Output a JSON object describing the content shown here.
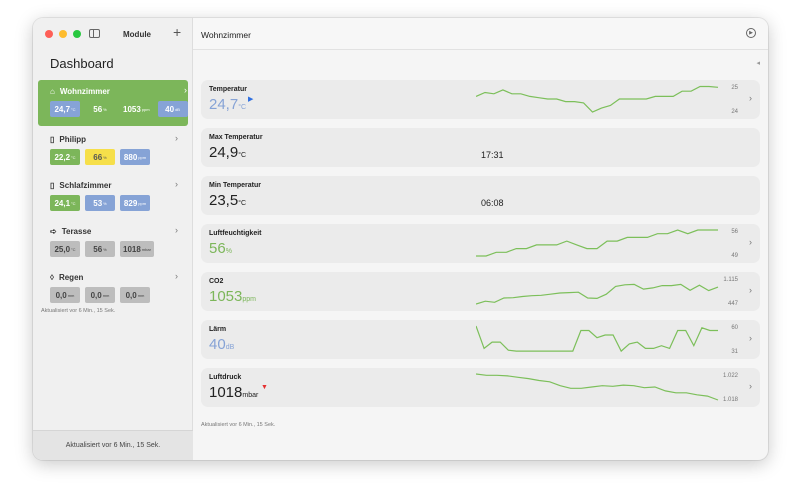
{
  "colors": {
    "green": "#7cb65a",
    "blue": "#86a3d6",
    "yellow": "#f6df4a",
    "gray": "#bdbdbd",
    "selected": "#7cb65a",
    "line": "#7cbf5a",
    "up": "#2f6fe0",
    "down": "#e53030"
  },
  "sidebar": {
    "title": "Module",
    "heading": "Dashboard",
    "updated": "Aktualisiert vor 6 Min., 15 Sek.",
    "footer": "Aktualisiert vor 6 Min., 15 Sek.",
    "rooms": [
      {
        "name": "Wohnzimmer",
        "icon": "house-icon",
        "selected": true,
        "chips": [
          {
            "v": "24,7",
            "u": "°C",
            "c": "blue"
          },
          {
            "v": "56",
            "u": "%",
            "c": "green"
          },
          {
            "v": "1053",
            "u": "ppm",
            "c": "green"
          },
          {
            "v": "40",
            "u": "dB",
            "c": "blue"
          }
        ]
      },
      {
        "name": "Philipp",
        "icon": "device-icon",
        "chips": [
          {
            "v": "22,2",
            "u": "°C",
            "c": "green"
          },
          {
            "v": "66",
            "u": "%",
            "c": "yellow"
          },
          {
            "v": "880",
            "u": "ppm",
            "c": "blue"
          }
        ]
      },
      {
        "name": "Schlafzimmer",
        "icon": "device-icon",
        "chips": [
          {
            "v": "24,1",
            "u": "°C",
            "c": "green"
          },
          {
            "v": "53",
            "u": "%",
            "c": "blue"
          },
          {
            "v": "829",
            "u": "ppm",
            "c": "blue"
          }
        ]
      },
      {
        "name": "Terasse",
        "icon": "wind-icon",
        "chips": [
          {
            "v": "25,0",
            "u": "°C",
            "c": "gray"
          },
          {
            "v": "56",
            "u": "%",
            "c": "gray"
          },
          {
            "v": "1018",
            "u": "mbar",
            "c": "gray"
          }
        ]
      },
      {
        "name": "Regen",
        "icon": "drop-icon",
        "chips": [
          {
            "v": "0,0",
            "u": "mm",
            "c": "gray"
          },
          {
            "v": "0,0",
            "u": "mm",
            "c": "gray"
          },
          {
            "v": "0,0",
            "u": "mm",
            "c": "gray"
          }
        ]
      }
    ]
  },
  "main": {
    "title": "Wohnzimmer",
    "updated": "Aktualisiert vor 6 Min., 15 Sek.",
    "cards": [
      {
        "label": "Temperatur",
        "value": "24,7",
        "unit": "°C",
        "color": "#86a3d6",
        "mark": "▶",
        "markColor": "#2f6fe0",
        "hi": "25",
        "lo": "24",
        "range": [
          24,
          25
        ],
        "series": [
          24.6,
          24.75,
          24.7,
          24.85,
          24.7,
          24.7,
          24.6,
          24.55,
          24.5,
          24.5,
          24.4,
          24.4,
          24.35,
          24.0,
          24.15,
          24.25,
          24.5,
          24.5,
          24.5,
          24.5,
          24.6,
          24.6,
          24.6,
          24.8,
          24.8,
          24.98,
          24.98,
          24.95
        ]
      },
      {
        "label": "Max Temperatur",
        "value": "24,9",
        "unit": "°C",
        "color": "#222",
        "time": "17:31"
      },
      {
        "label": "Min Temperatur",
        "value": "23,5",
        "unit": "°C",
        "color": "#222",
        "time": "06:08"
      },
      {
        "label": "Luftfeuchtigkeit",
        "value": "56",
        "unit": "%",
        "color": "#7cb65a",
        "hi": "56",
        "lo": "49",
        "range": [
          49,
          56
        ],
        "series": [
          49,
          49,
          50,
          50,
          51,
          51,
          52,
          52,
          52,
          53,
          52,
          51,
          51,
          53,
          53,
          54,
          54,
          54,
          55,
          55,
          56,
          55,
          56,
          56,
          56
        ]
      },
      {
        "label": "CO2",
        "value": "1053",
        "unit": "ppm",
        "color": "#7cb65a",
        "hi": "1.115",
        "lo": "447",
        "range": [
          447,
          1115
        ],
        "series": [
          447,
          520,
          490,
          600,
          610,
          640,
          660,
          670,
          700,
          730,
          740,
          750,
          600,
          590,
          700,
          900,
          940,
          950,
          830,
          860,
          920,
          920,
          950,
          800,
          930,
          790,
          880
        ]
      },
      {
        "label": "Lärm",
        "value": "40",
        "unit": "dB",
        "color": "#86a3d6",
        "hi": "60",
        "lo": "31",
        "range": [
          31,
          60
        ],
        "series": [
          60,
          35,
          42,
          42,
          33,
          32,
          32,
          32,
          32,
          32,
          32,
          32,
          32,
          55,
          55,
          47,
          50,
          50,
          32,
          40,
          42,
          35,
          35,
          38,
          35,
          55,
          55,
          38,
          58,
          55,
          55
        ]
      },
      {
        "label": "Luftdruck",
        "value": "1018",
        "unit": "mbar",
        "color": "#222",
        "mark": "▼",
        "markColor": "#e53030",
        "hi": "1.022",
        "lo": "1.018",
        "range": [
          1018,
          1022
        ],
        "series": [
          1022,
          1021.8,
          1021.8,
          1021.7,
          1021.5,
          1021.3,
          1021,
          1020.8,
          1020.2,
          1019.8,
          1019.8,
          1020,
          1020.2,
          1020.1,
          1020.3,
          1020.2,
          1019.9,
          1020,
          1019.4,
          1019.1,
          1019.1,
          1018.8,
          1018.6,
          1018
        ]
      }
    ]
  }
}
